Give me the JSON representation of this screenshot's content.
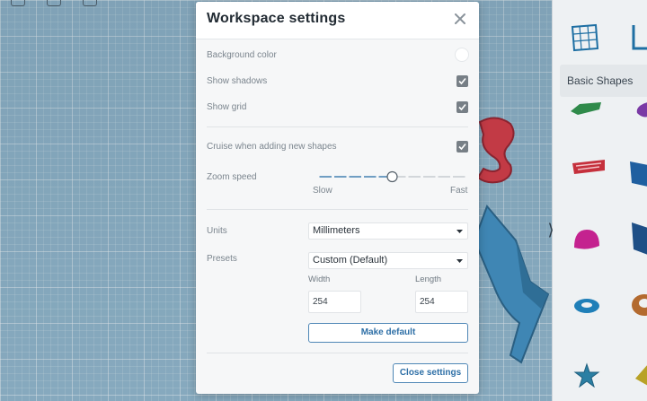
{
  "modal": {
    "title": "Workspace settings",
    "background_color": {
      "label": "Background color",
      "value": "#ffffff"
    },
    "show_shadows": {
      "label": "Show shadows",
      "checked": true
    },
    "show_grid": {
      "label": "Show grid",
      "checked": true
    },
    "cruise": {
      "label": "Cruise when adding new shapes",
      "checked": true
    },
    "zoom_speed": {
      "label": "Zoom speed",
      "min_label": "Slow",
      "max_label": "Fast",
      "level": 0.5
    },
    "units": {
      "label": "Units",
      "value": "Millimeters"
    },
    "presets": {
      "label": "Presets",
      "value": "Custom (Default)"
    },
    "width": {
      "label": "Width",
      "value": "254"
    },
    "length": {
      "label": "Length",
      "value": "254"
    },
    "make_default_label": "Make default",
    "close_settings_label": "Close settings"
  },
  "shapes_panel": {
    "category": "Basic Shapes",
    "shape_icons": [
      "workplane-icon",
      "ruler-icon",
      "roof-icon",
      "paraboloid-icon",
      "text-icon",
      "box-icon",
      "half-sphere-icon",
      "wedge-icon",
      "torus-icon",
      "tube-icon",
      "star-icon",
      "pyramid-icon"
    ]
  },
  "colors": {
    "accent": "#2e6fa6",
    "checkbox": "#777f86",
    "workplane": "#93b7cc"
  }
}
